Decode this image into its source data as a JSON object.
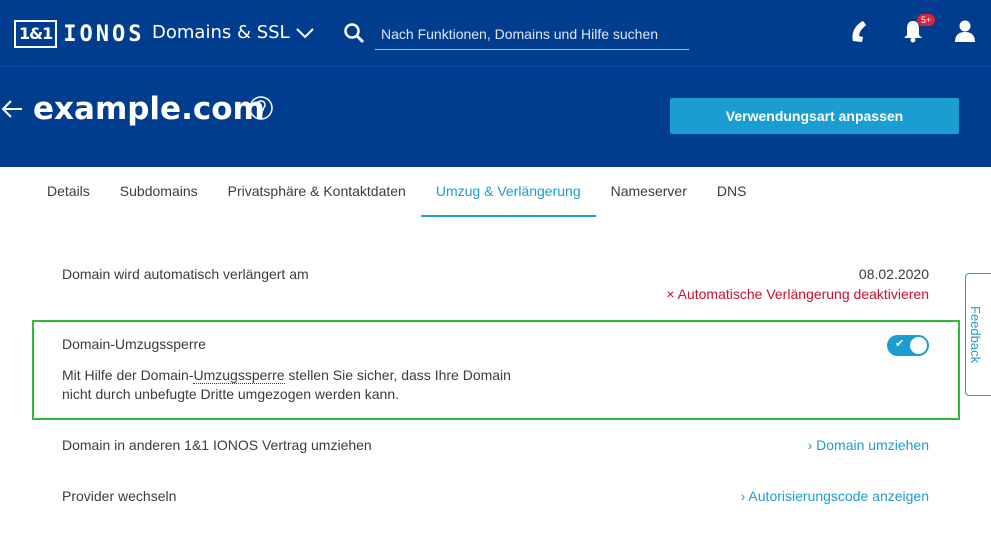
{
  "topbar": {
    "logo_box": "1&1",
    "logo_text": "IONOS",
    "section_title": "Domains & SSL",
    "search_placeholder": "Nach Funktionen, Domains und Hilfe suchen",
    "notifications_badge": "5+",
    "icons": [
      "search-icon",
      "phone-icon",
      "bell-icon",
      "user-icon",
      "chevron-down-icon"
    ]
  },
  "header": {
    "domain": "example.com",
    "primary_button": "Verwendungsart anpassen"
  },
  "tabs": [
    {
      "label": "Details",
      "active": false
    },
    {
      "label": "Subdomains",
      "active": false
    },
    {
      "label": "Privatsphäre & Kontaktdaten",
      "active": false
    },
    {
      "label": "Umzug & Verlängerung",
      "active": true
    },
    {
      "label": "Nameserver",
      "active": false
    },
    {
      "label": "DNS",
      "active": false
    }
  ],
  "renewal": {
    "label": "Domain wird automatisch verlängert am",
    "date": "08.02.2020",
    "deactivate_link": "× Automatische Verlängerung deaktivieren"
  },
  "transfer_lock": {
    "title": "Domain-Umzugssperre",
    "desc_part1": "Mit Hilfe der Domain-",
    "desc_dotted": "Umzugssperre",
    "desc_part2": " stellen Sie sicher, dass Ihre Domain nicht durch unbefugte Dritte umgezogen werden kann.",
    "enabled": true
  },
  "move_contract": {
    "label": "Domain in anderen 1&1 IONOS Vertrag umziehen",
    "link": "› Domain umziehen"
  },
  "provider": {
    "label": "Provider wechseln",
    "link": "› Autorisierungscode anzeigen"
  },
  "feedback": {
    "label": "Feedback"
  },
  "colors": {
    "brand_blue": "#003d8f",
    "accent": "#1a9dd0",
    "warning": "#c8102e",
    "highlight": "#2fba3c"
  }
}
